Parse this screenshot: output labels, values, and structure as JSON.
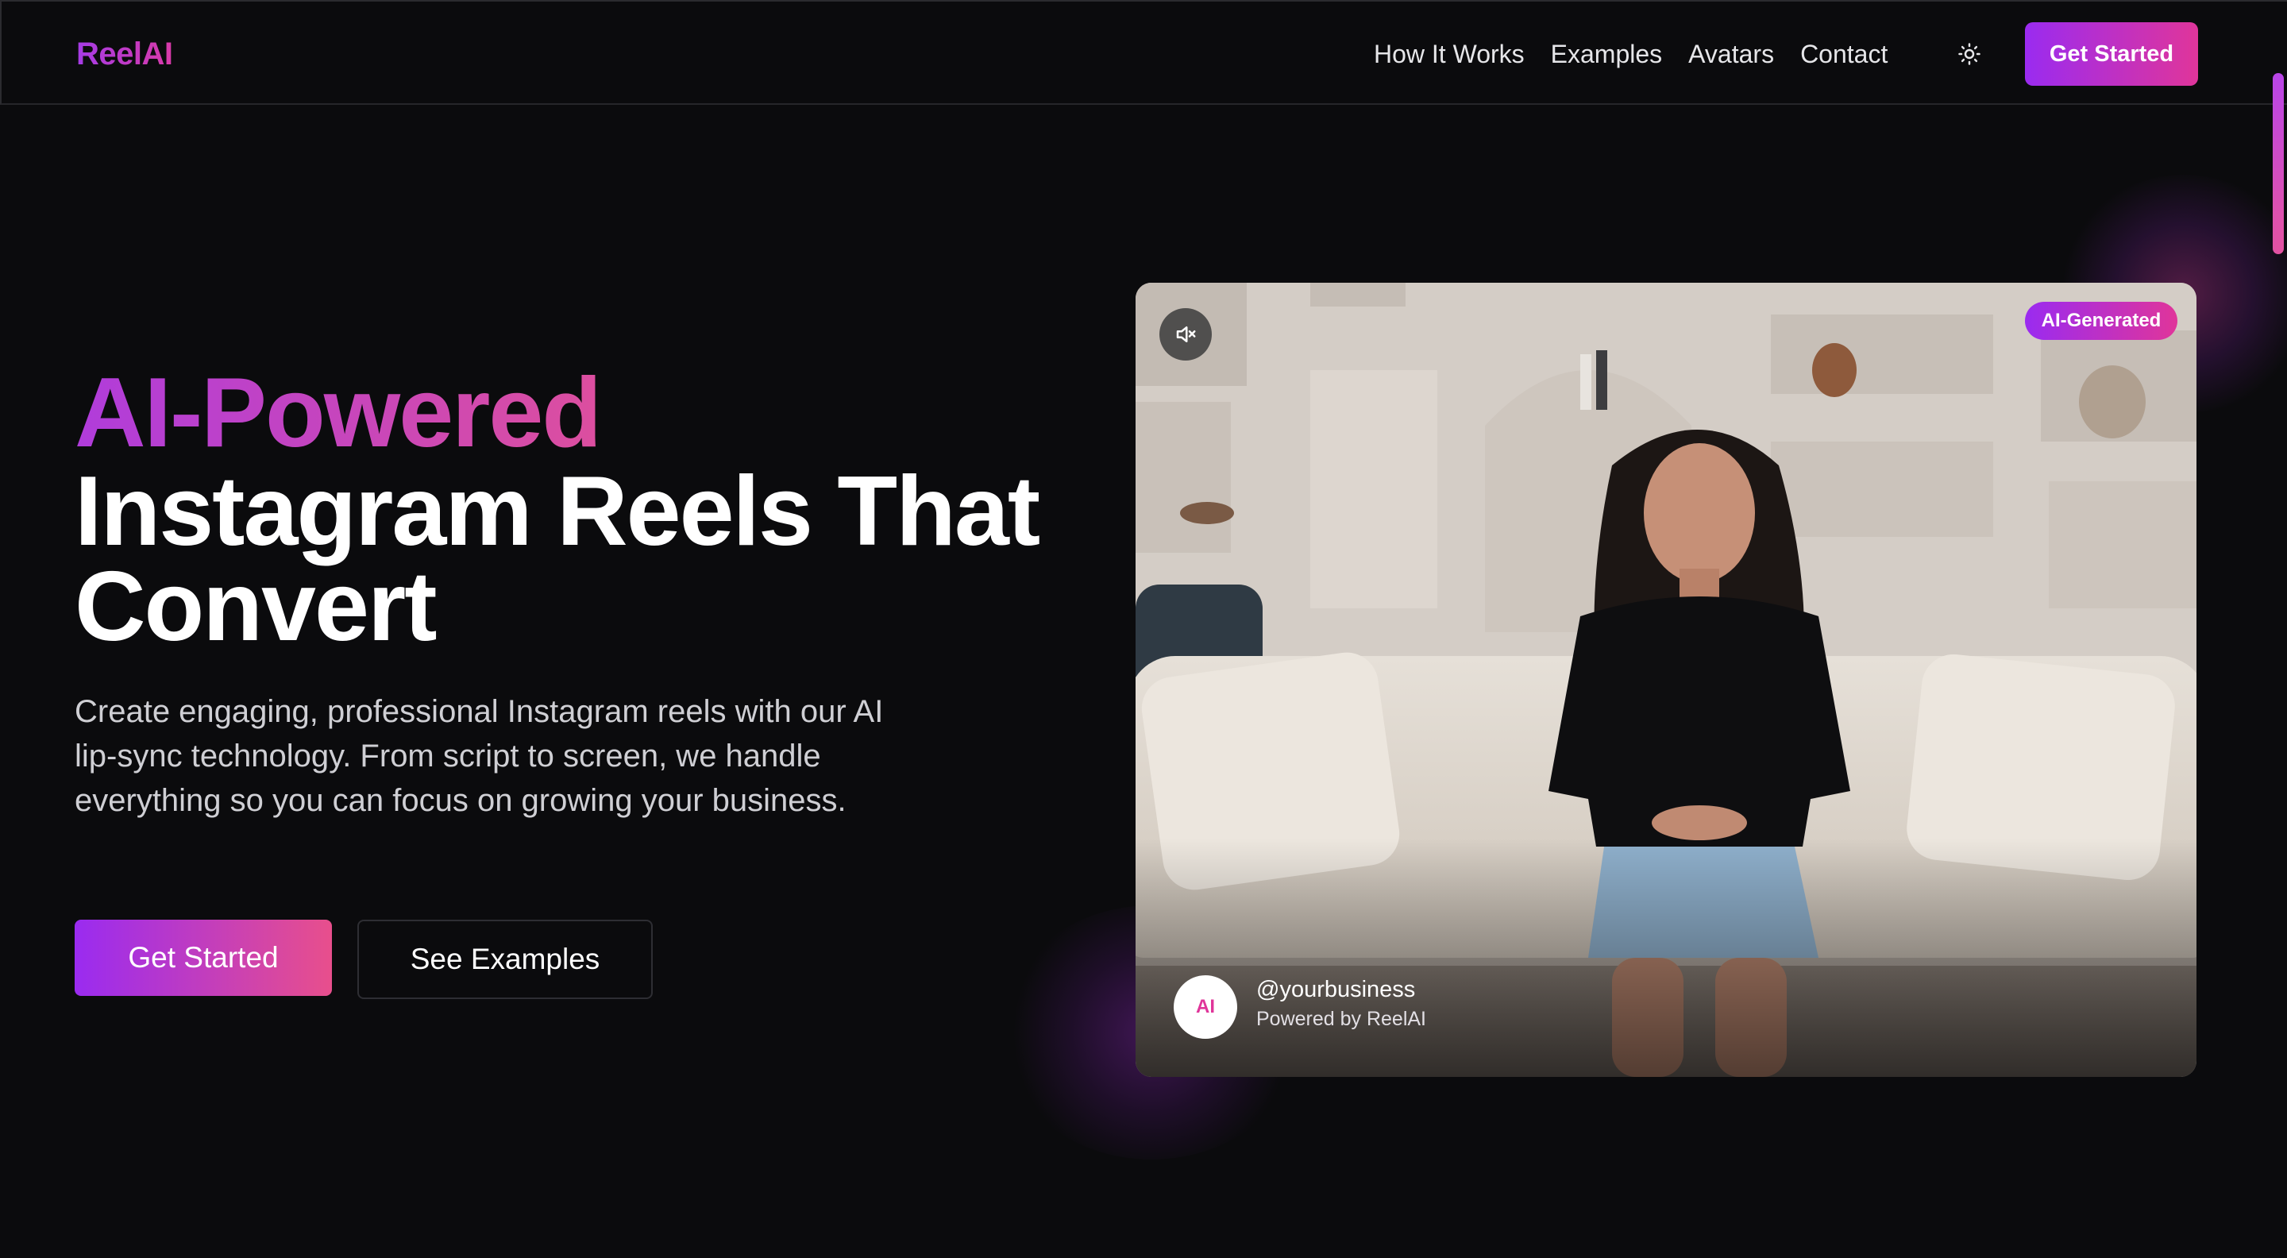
{
  "brand": {
    "name": "ReelAI"
  },
  "nav": {
    "links": [
      "How It Works",
      "Examples",
      "Avatars",
      "Contact"
    ],
    "theme_icon": "sun-icon",
    "cta_label": "Get Started"
  },
  "hero": {
    "headline_gradient": "AI-Powered",
    "headline_line2": "Instagram Reels That",
    "headline_line3": "Convert",
    "subtext": "Create engaging, professional Instagram reels with our AI lip-sync technology. From script to screen, we handle everything so you can focus on growing your business.",
    "primary_button": "Get Started",
    "secondary_button": "See Examples"
  },
  "video": {
    "badge": "AI-Generated",
    "mute_icon": "volume-mute-icon",
    "avatar_initials": "AI",
    "handle": "@yourbusiness",
    "powered_by": "Powered by ReelAI"
  },
  "colors": {
    "background": "#0b0b0d",
    "accent_start": "#9a2bf0",
    "accent_end": "#e0359a"
  }
}
